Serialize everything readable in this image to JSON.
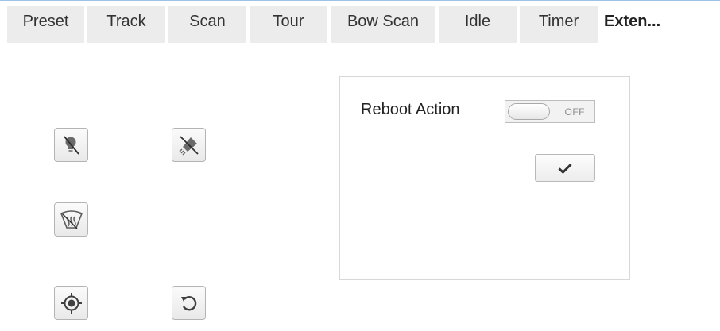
{
  "tabs": [
    {
      "label": "Preset",
      "active": false
    },
    {
      "label": "Track",
      "active": false
    },
    {
      "label": "Scan",
      "active": false
    },
    {
      "label": "Tour",
      "active": false
    },
    {
      "label": "Bow Scan",
      "active": false
    },
    {
      "label": "Idle",
      "active": false
    },
    {
      "label": "Timer",
      "active": false
    },
    {
      "label": "Exten...",
      "active": true
    }
  ],
  "buttons": [
    {
      "name": "light-off-button",
      "icon": "light-off-icon"
    },
    {
      "name": "wiper-off-button",
      "icon": "wiper-off-icon"
    },
    {
      "name": "defog-button",
      "icon": "defog-icon"
    },
    {
      "name": "focus-target-button",
      "icon": "target-icon"
    },
    {
      "name": "reset-button",
      "icon": "rotate-ccw-icon"
    }
  ],
  "reboot": {
    "label": "Reboot Action",
    "toggle_state": "OFF",
    "confirm_icon": "checkmark-icon"
  },
  "colors": {
    "tab_bg": "#ececec",
    "top_rule": "#9cc3e6",
    "icon_fg": "#5a5a5a"
  }
}
